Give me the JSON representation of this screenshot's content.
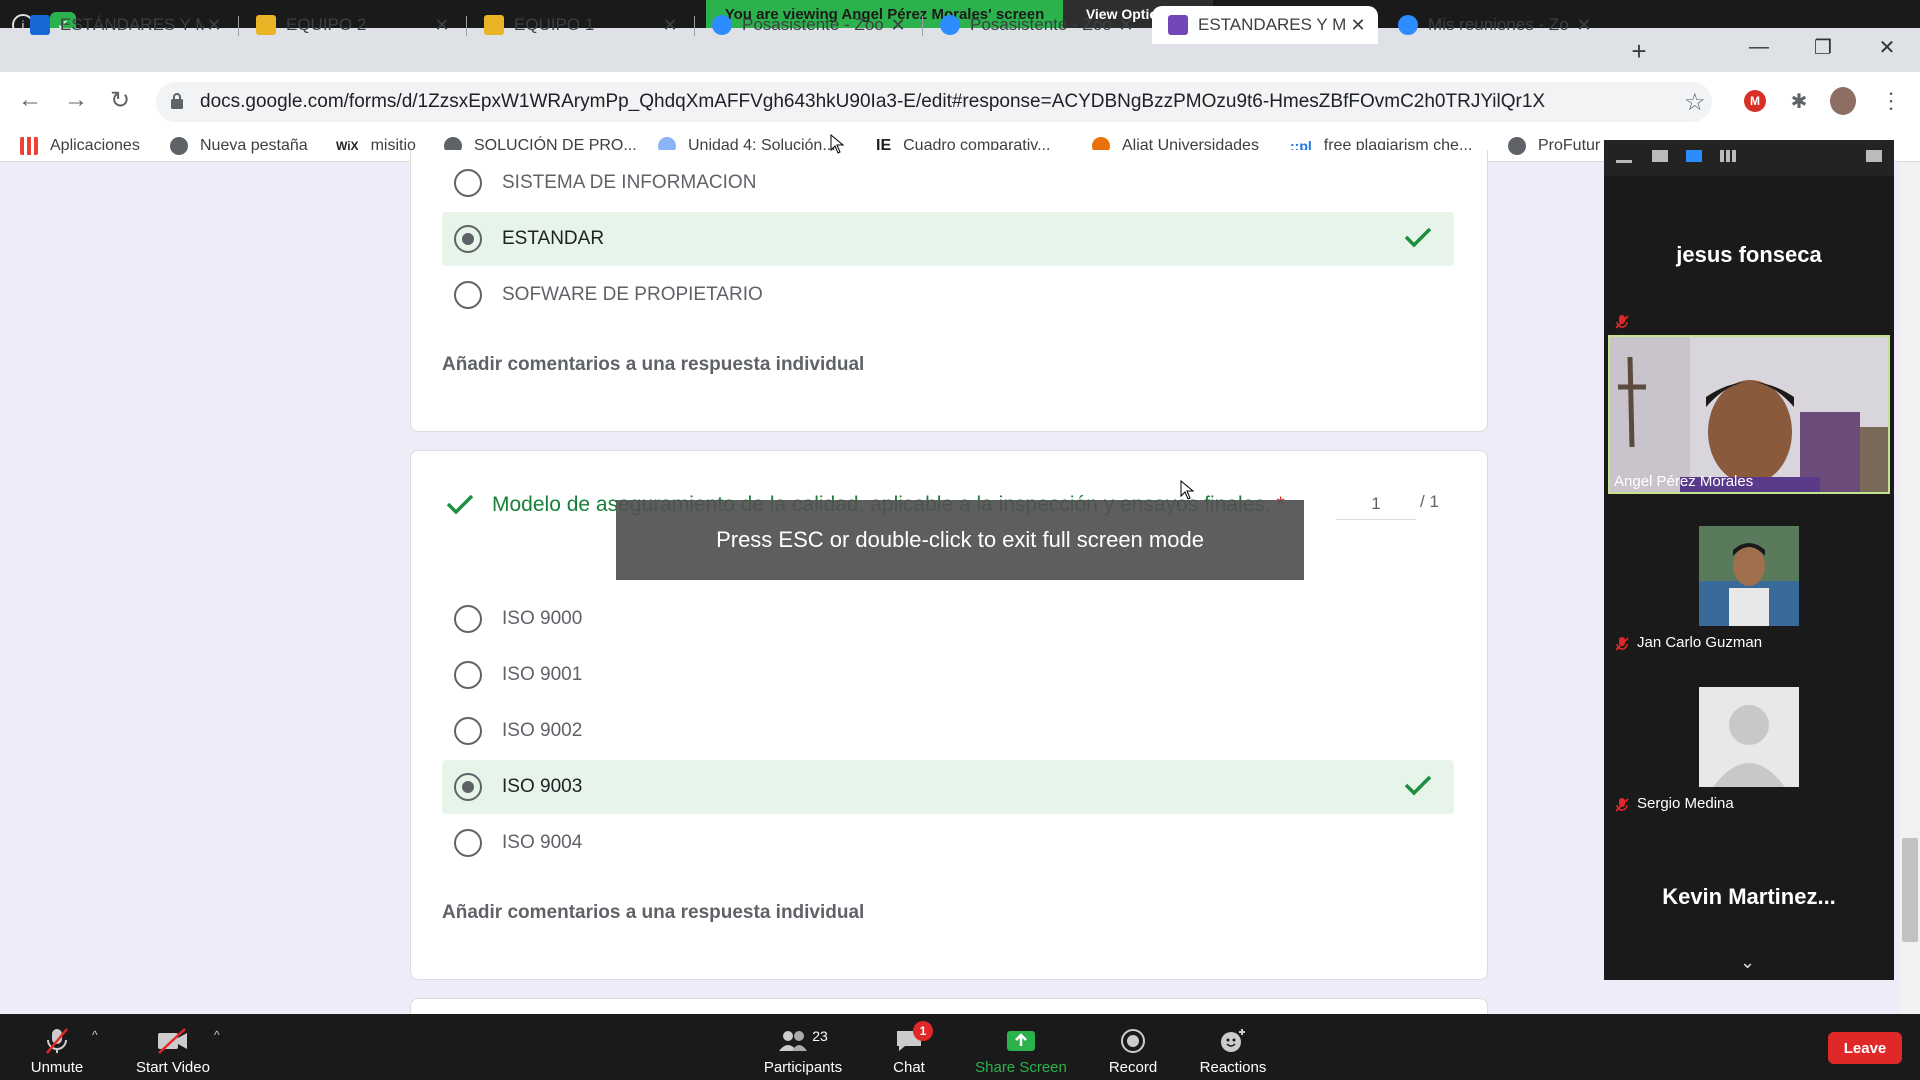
{
  "zoom": {
    "viewing_banner": "You are viewing Angel Pérez  Morales' screen",
    "view_options": "View Options",
    "toolbar": {
      "unmute": "Unmute",
      "start_video": "Start Video",
      "participants": "Participants",
      "participants_count": "23",
      "chat": "Chat",
      "chat_badge": "1",
      "share_screen": "Share Screen",
      "record": "Record",
      "reactions": "Reactions",
      "leave": "Leave"
    },
    "participants": {
      "top_name": "jesus fonseca",
      "video_name": "Angel Pérez  Morales",
      "p2": "Jan Carlo Guzman",
      "p3": "Sergio Medina",
      "bottom_name": "Kevin  Martinez..."
    },
    "colors": {
      "share_green": "#2bb24c",
      "leave_red": "#e02828"
    }
  },
  "browser": {
    "tabs": [
      {
        "title": "ESTÁNDARES Y M",
        "icon": "google-classroom-icon"
      },
      {
        "title": "EQUIPO 2",
        "icon": "google-classroom-icon"
      },
      {
        "title": "EQUIPO 1",
        "icon": "google-classroom-icon"
      },
      {
        "title": "Posasistente - Zoo",
        "icon": "zoom-icon"
      },
      {
        "title": "Posasistente - Zoo",
        "icon": "zoom-icon"
      },
      {
        "title": "ESTANDARES Y M",
        "icon": "google-forms-icon"
      },
      {
        "title": "Mis reuniones - Zo",
        "icon": "zoom-icon"
      }
    ],
    "url": "docs.google.com/forms/d/1ZzsxEpxW1WRArymPp_QhdqXmAFFVgh643hkU90Ia3-E/edit#response=ACYDBNgBzzPMOzu9t6-HmesZBfFOvmC2h0TRJYilQr1X",
    "bookmarks": [
      "Aplicaciones",
      "Nueva pestaña",
      "misitio",
      "SOLUCIÓN DE PRO...",
      "Unidad 4: Solución...",
      "Cuadro comparativ...",
      "Aliat Universidades",
      "free plagiarism che...",
      "ProFutur"
    ],
    "wix_label": "WiX",
    "pl_label": "::pl",
    "ie_label": "IE"
  },
  "form": {
    "q1_options": [
      "SISTEMA DE INFORMACION",
      "ESTANDAR",
      "SOFWARE DE PROPIETARIO"
    ],
    "comments_label": "Añadir comentarios a una respuesta individual",
    "q2_title": "Modelo de aseguramiento de la calidad, aplicable a la inspección y ensayos finales.",
    "required_mark": "*",
    "q2_points": "1",
    "q2_points_total": "/  1",
    "q2_options": [
      "ISO 9000",
      "ISO 9001",
      "ISO 9002",
      "ISO 9003",
      "ISO 9004"
    ],
    "colors": {
      "correct_bg": "#e6f4ea",
      "correct_check": "#1e8e3e"
    }
  },
  "fullscreen_toast": "Press ESC or double-click to exit full screen mode"
}
